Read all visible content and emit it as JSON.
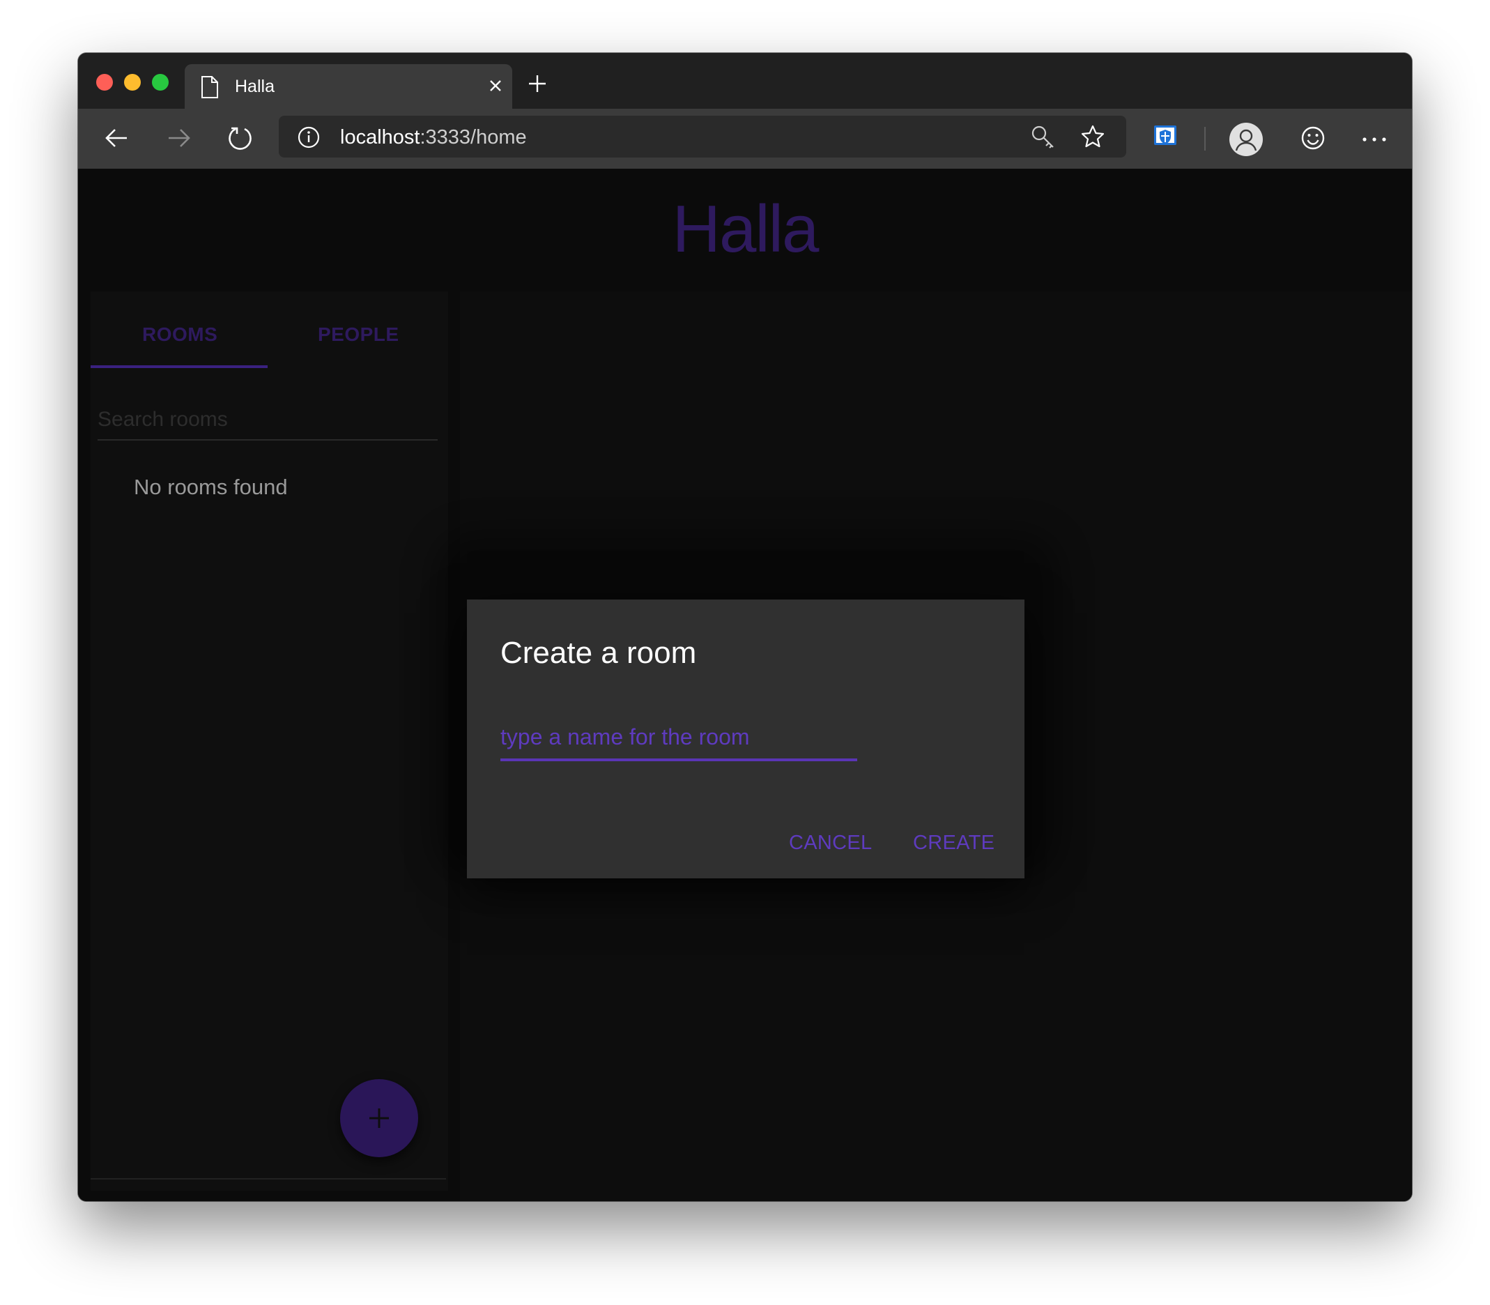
{
  "browser": {
    "tab_title": "Halla",
    "url_host": "localhost",
    "url_rest": ":3333/home"
  },
  "app": {
    "title": "Halla",
    "tabs": [
      {
        "label": "ROOMS",
        "active": true
      },
      {
        "label": "PEOPLE",
        "active": false
      }
    ],
    "search_placeholder": "Search rooms",
    "empty_message": "No rooms found",
    "fab_label": "+"
  },
  "dialog": {
    "title": "Create a room",
    "input_placeholder": "type a name for the room",
    "cancel_label": "CANCEL",
    "create_label": "CREATE"
  },
  "colors": {
    "accent": "#5e3bbf",
    "accent_dim": "#2e1a5e",
    "dialog_bg": "#303030",
    "page_bg": "#0b0b0b"
  },
  "icons": [
    "page-icon",
    "close-icon",
    "plus-icon",
    "back-arrow-icon",
    "forward-arrow-icon",
    "reload-icon",
    "info-icon",
    "key-icon",
    "star-icon",
    "shield-icon",
    "profile-icon",
    "smiley-icon",
    "more-icon"
  ]
}
